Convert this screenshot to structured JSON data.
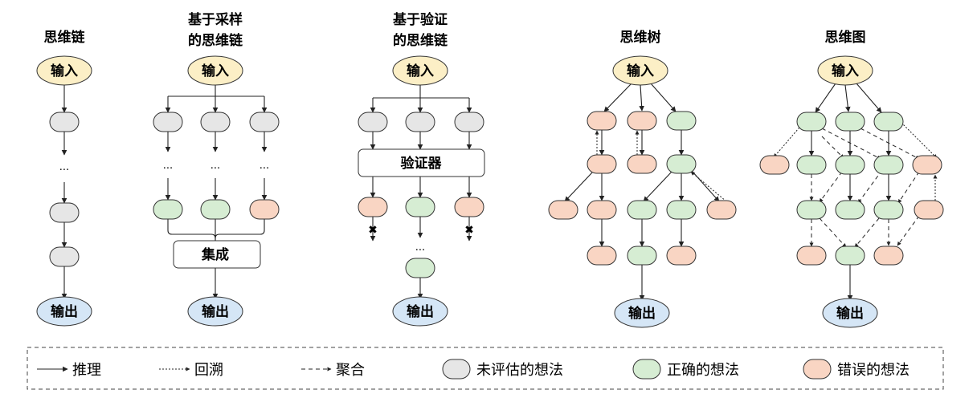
{
  "columns": {
    "cot": {
      "title": "思维链"
    },
    "sc": {
      "title_line1": "基于采样",
      "title_line2": "的思维链"
    },
    "ver": {
      "title_line1": "基于验证",
      "title_line2": "的思维链"
    },
    "tot": {
      "title": "思维树"
    },
    "got": {
      "title": "思维图"
    }
  },
  "nodes": {
    "input": "输入",
    "output": "输出",
    "ensemble": "集成",
    "verifier": "验证器",
    "ellipsis": "..."
  },
  "legend": {
    "reasoning": "推理",
    "backtrack": "回溯",
    "aggregate": "聚合",
    "unevaluated": "未评估的想法",
    "correct": "正确的想法",
    "wrong": "错误的想法"
  },
  "colors": {
    "input_fill": "#FCEFC6",
    "output_fill": "#D5E6F6",
    "unevaluated_fill": "#E6E6E6",
    "correct_fill": "#D6EDD3",
    "wrong_fill": "#F9D5C3",
    "stroke": "#333333"
  }
}
